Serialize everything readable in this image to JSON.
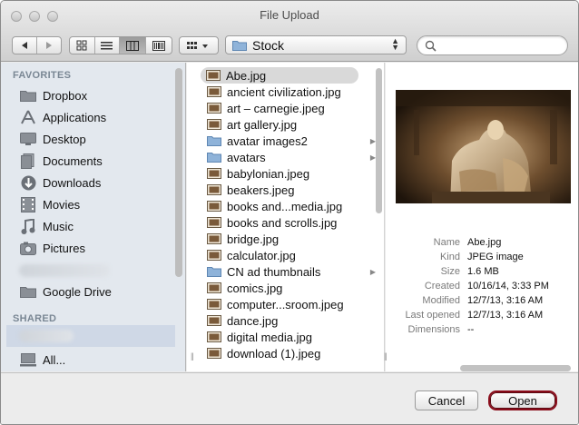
{
  "window": {
    "title": "File Upload"
  },
  "toolbar": {
    "path_label": "Stock",
    "search_placeholder": ""
  },
  "sidebar": {
    "favorites_header": "FAVORITES",
    "favorites": [
      {
        "label": "Dropbox",
        "icon": "folder-icon"
      },
      {
        "label": "Applications",
        "icon": "applications-icon"
      },
      {
        "label": "Desktop",
        "icon": "desktop-icon"
      },
      {
        "label": "Documents",
        "icon": "documents-icon"
      },
      {
        "label": "Downloads",
        "icon": "downloads-icon"
      },
      {
        "label": "Movies",
        "icon": "movies-icon"
      },
      {
        "label": "Music",
        "icon": "music-icon"
      },
      {
        "label": "Pictures",
        "icon": "pictures-icon"
      },
      {
        "label": "Google Drive",
        "icon": "folder-icon"
      }
    ],
    "shared_header": "SHARED",
    "shared": [
      {
        "label": "All...",
        "icon": "network-icon"
      }
    ]
  },
  "files": [
    {
      "name": "Abe.jpg",
      "type": "image",
      "selected": true
    },
    {
      "name": "ancient civilization.jpg",
      "type": "image"
    },
    {
      "name": "art – carnegie.jpeg",
      "type": "image"
    },
    {
      "name": "art gallery.jpg",
      "type": "image"
    },
    {
      "name": "avatar images2",
      "type": "folder"
    },
    {
      "name": "avatars",
      "type": "folder"
    },
    {
      "name": "babylonian.jpeg",
      "type": "image"
    },
    {
      "name": "beakers.jpeg",
      "type": "image"
    },
    {
      "name": "books and...media.jpg",
      "type": "image"
    },
    {
      "name": "books and scrolls.jpg",
      "type": "image"
    },
    {
      "name": "bridge.jpg",
      "type": "image"
    },
    {
      "name": "calculator.jpg",
      "type": "image"
    },
    {
      "name": "CN ad thumbnails",
      "type": "folder"
    },
    {
      "name": "comics.jpg",
      "type": "image"
    },
    {
      "name": "computer...sroom.jpeg",
      "type": "image"
    },
    {
      "name": "dance.jpg",
      "type": "image"
    },
    {
      "name": "digital media.jpg",
      "type": "image"
    },
    {
      "name": "download (1).jpeg",
      "type": "image"
    }
  ],
  "preview": {
    "meta": [
      {
        "key": "Name",
        "value": "Abe.jpg"
      },
      {
        "key": "Kind",
        "value": "JPEG image"
      },
      {
        "key": "Size",
        "value": "1.6 MB"
      },
      {
        "key": "Created",
        "value": "10/16/14, 3:33 PM"
      },
      {
        "key": "Modified",
        "value": "12/7/13, 3:16 AM"
      },
      {
        "key": "Last opened",
        "value": "12/7/13, 3:16 AM"
      },
      {
        "key": "Dimensions",
        "value": "--"
      }
    ]
  },
  "buttons": {
    "cancel": "Cancel",
    "open": "Open"
  },
  "colors": {
    "open_button_border": "#8a0d1b",
    "selection": "#d9d9d9",
    "sidebar_bg": "#e3e8ee"
  }
}
